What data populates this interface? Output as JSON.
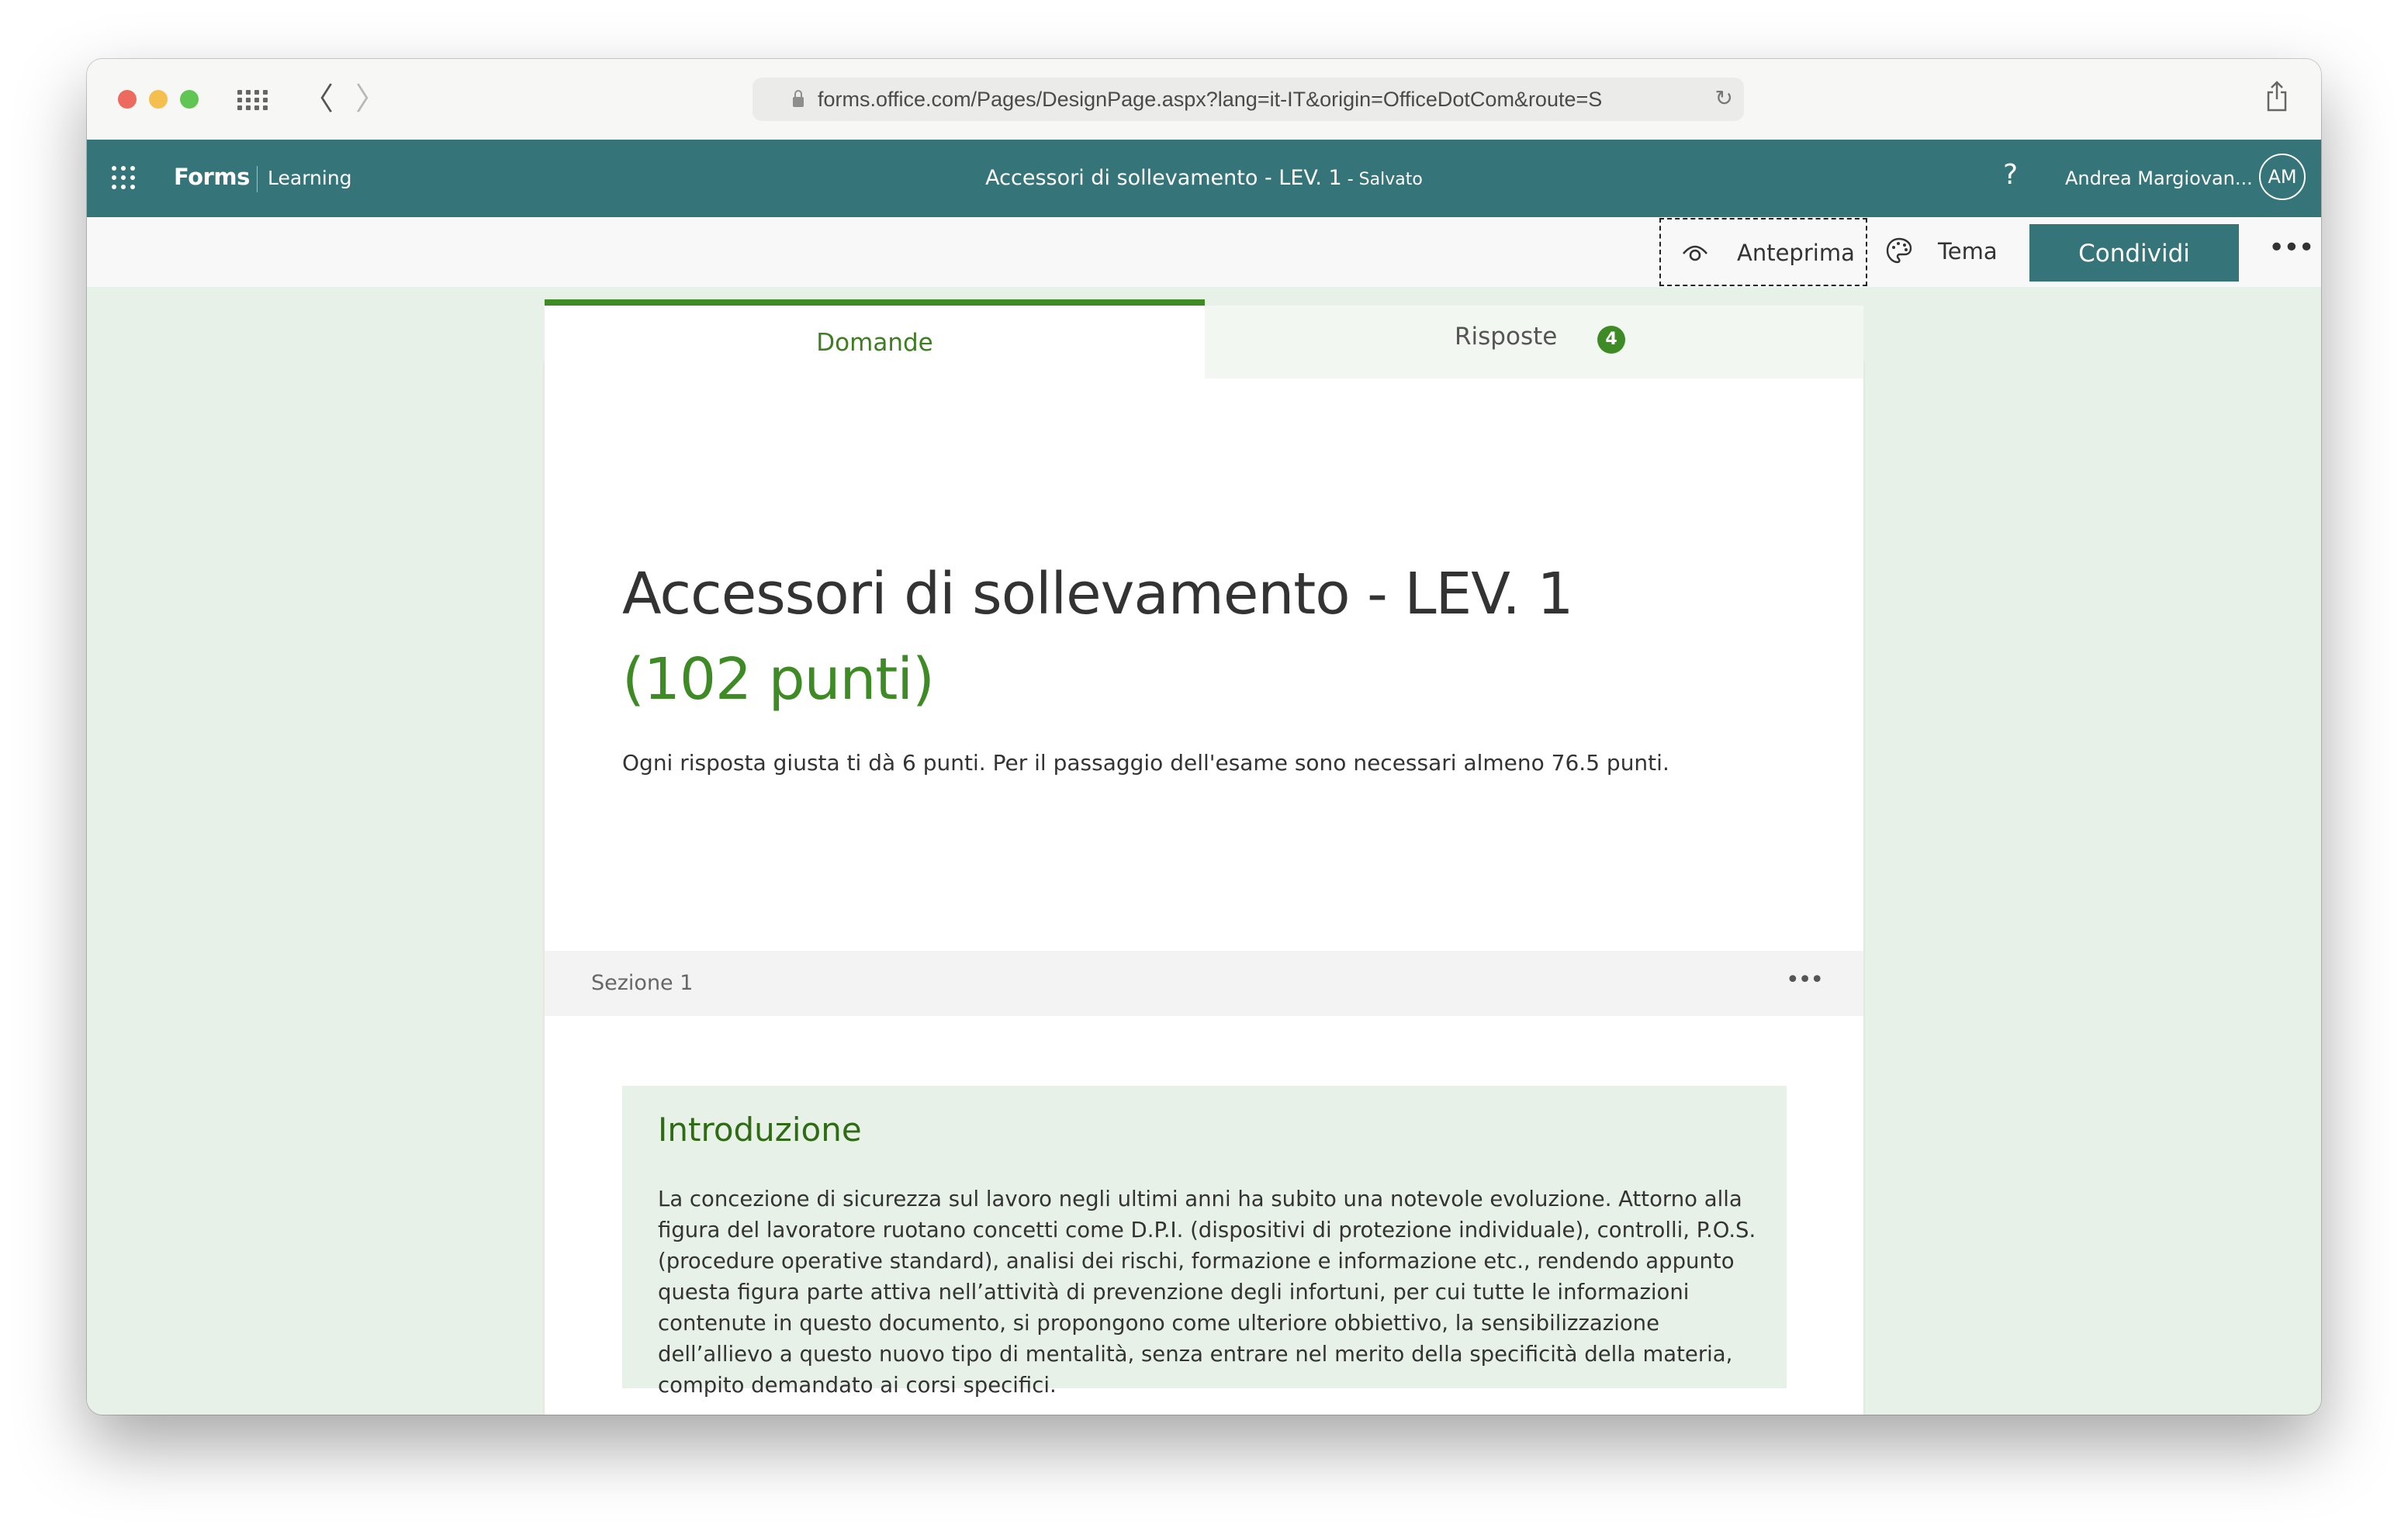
{
  "browser": {
    "url": "forms.office.com/Pages/DesignPage.aspx?lang=it-IT&origin=OfficeDotCom&route=S",
    "icons": {
      "lock": "lock-icon",
      "reload": "reload-icon",
      "share": "share-icon",
      "back": "chevron-left-icon",
      "forward": "chevron-right-icon",
      "tabs": "grid-icon"
    },
    "back_glyph": "〈",
    "forward_glyph": "〉",
    "reload_glyph": "↻"
  },
  "app_bar": {
    "app_name": "Forms",
    "org": "Learning",
    "doc_title": "Accessori di sollevamento - LEV. 1",
    "save_status": " - Salvato",
    "help_glyph": "?",
    "user_name": "Andrea Margiovan...",
    "avatar_initials": "AM",
    "bg_color": "#357478"
  },
  "command_bar": {
    "preview_label": "Anteprima",
    "theme_label": "Tema",
    "share_label": "Condividi",
    "more_glyph": "•••"
  },
  "tabs": [
    {
      "label": "Domande",
      "active": true
    },
    {
      "label": "Risposte",
      "badge": "4",
      "active": false
    }
  ],
  "form": {
    "title": "Accessori di sollevamento - LEV. 1",
    "points": "(102 punti)",
    "description": "Ogni risposta giusta ti dà 6 punti. Per il passaggio dell'esame sono necessari almeno 76.5 punti.",
    "accent_color": "#3e8b26"
  },
  "section": {
    "label": "Sezione 1",
    "more_glyph": "•••"
  },
  "intro": {
    "title": "Introduzione",
    "text": "La concezione di sicurezza sul lavoro negli ultimi anni ha subito una notevole evoluzione. Attorno alla figura del lavoratore ruotano concetti come D.P.I. (dispositivi di protezione individuale), controlli, P.O.S. (procedure operative standard), analisi dei rischi, formazione e informazione etc., rendendo appunto questa figura parte attiva nell’attività di prevenzione degli infortuni, per cui tutte le informazioni contenute in questo documento, si propongono come ulteriore obbiettivo, la sensibilizzazione dell’allievo a questo nuovo tipo di mentalità, senza entrare nel merito della specificità della materia, compito demandato ai corsi specifici."
  }
}
